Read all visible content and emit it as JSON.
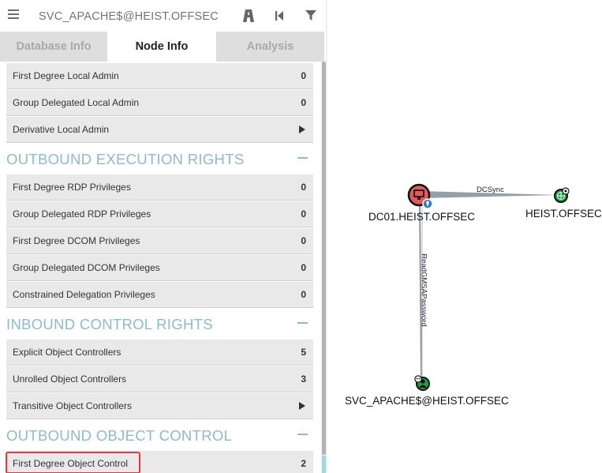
{
  "search": {
    "query": "SVC_APACHE$@HEIST.OFFSEC"
  },
  "toolbar": {
    "icons": [
      "menu-icon",
      "pathfinding-icon",
      "back-icon",
      "filter-icon"
    ]
  },
  "tabs": {
    "database": "Database Info",
    "node": "Node Info",
    "analysis": "Analysis",
    "active": "Node Info"
  },
  "node_info": {
    "rows_top": [
      {
        "label": "First Degree Local Admin",
        "value": "0"
      },
      {
        "label": "Group Delegated Local Admin",
        "value": "0"
      },
      {
        "label": "Derivative Local Admin",
        "value": ""
      }
    ],
    "sections": [
      {
        "title": "OUTBOUND EXECUTION RIGHTS",
        "rows": [
          {
            "label": "First Degree RDP Privileges",
            "value": "0"
          },
          {
            "label": "Group Delegated RDP Privileges",
            "value": "0"
          },
          {
            "label": "First Degree DCOM Privileges",
            "value": "0"
          },
          {
            "label": "Group Delegated DCOM Privileges",
            "value": "0"
          },
          {
            "label": "Constrained Delegation Privileges",
            "value": "0"
          }
        ]
      },
      {
        "title": "INBOUND CONTROL RIGHTS",
        "rows": [
          {
            "label": "Explicit Object Controllers",
            "value": "5"
          },
          {
            "label": "Unrolled Object Controllers",
            "value": "3"
          },
          {
            "label": "Transitive Object Controllers",
            "value": ""
          }
        ]
      },
      {
        "title": "OUTBOUND OBJECT CONTROL",
        "rows": [
          {
            "label": "First Degree Object Control",
            "value": "2"
          }
        ]
      }
    ]
  },
  "graph": {
    "nodes": [
      {
        "label": "DC01.HEIST.OFFSEC",
        "kind": "computer-icon"
      },
      {
        "label": "HEIST.OFFSEC",
        "kind": "domain-icon"
      },
      {
        "label": "SVC_APACHE$@HEIST.OFFSEC",
        "kind": "user-icon"
      }
    ],
    "edges": [
      {
        "label": "DCSync",
        "from": "DC01.HEIST.OFFSEC",
        "to": "HEIST.OFFSEC"
      },
      {
        "label": "ReadGMSAPassword",
        "from": "SVC_APACHE$@HEIST.OFFSEC",
        "to": "DC01.HEIST.OFFSEC"
      }
    ]
  },
  "colors": {
    "section_title": "#8cbccc",
    "row_background": "#e9e9e9",
    "highlight": "#e0393e",
    "computer_node": "#e8585a",
    "domain_node": "#17a34a",
    "user_node": "#17a34a"
  }
}
